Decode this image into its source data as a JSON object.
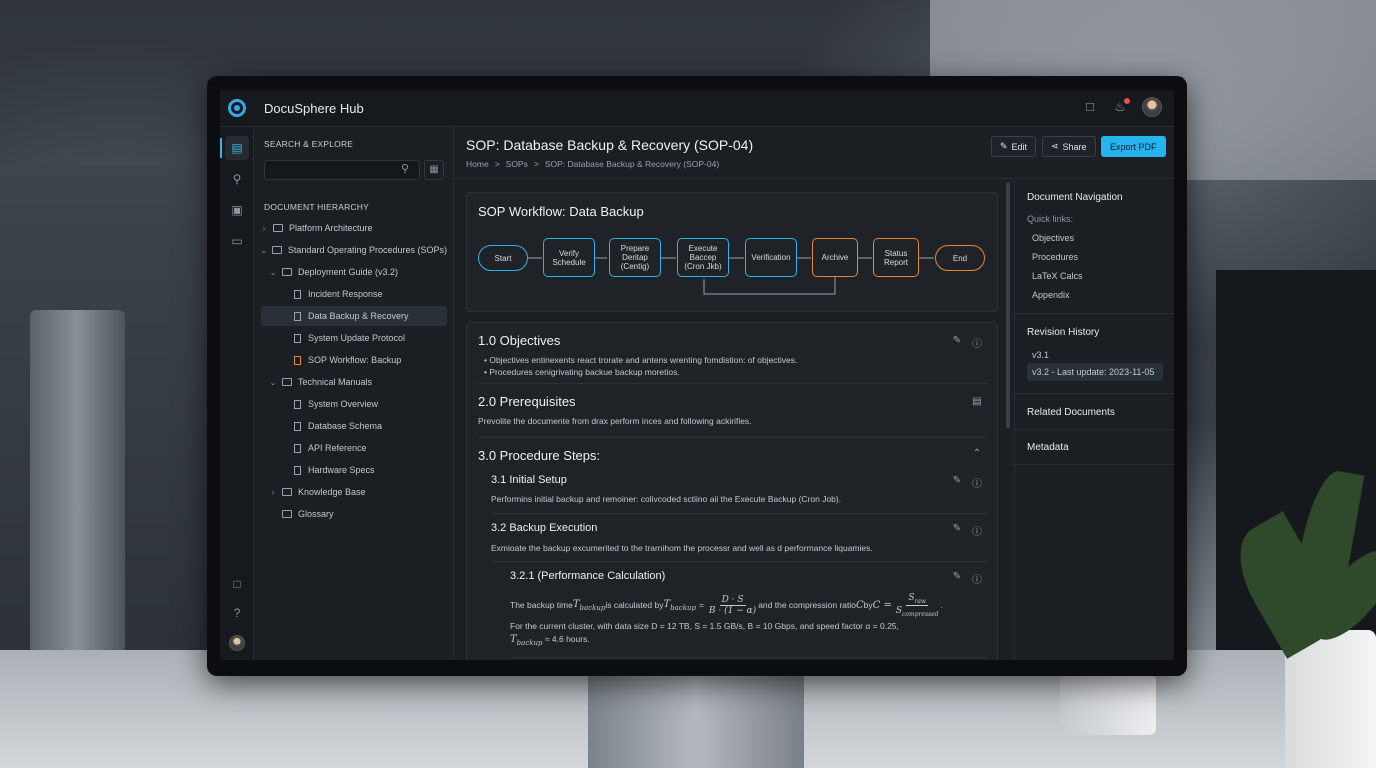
{
  "app": {
    "title": "DocuSphere Hub"
  },
  "sidebar": {
    "search_heading": "SEARCH & EXPLORE",
    "search_placeholder": "",
    "hierarchy_heading": "DOCUMENT HIERARCHY",
    "tree": [
      {
        "label": "Platform Architecture",
        "type": "folder",
        "expanded": false,
        "depth": 0
      },
      {
        "label": "Standard Operating Procedures (SOPs)",
        "type": "folder",
        "expanded": true,
        "depth": 0
      },
      {
        "label": "Deployment Guide (v3.2)",
        "type": "folder",
        "expanded": true,
        "depth": 1
      },
      {
        "label": "Incident Response",
        "type": "file",
        "depth": 2
      },
      {
        "label": "Data Backup & Recovery",
        "type": "file",
        "depth": 2,
        "selected": true
      },
      {
        "label": "System Update Protocol",
        "type": "file",
        "depth": 2
      },
      {
        "label": "SOP Workflow: Backup",
        "type": "file",
        "depth": 2,
        "accent": true
      },
      {
        "label": "Technical Manuals",
        "type": "folder",
        "expanded": true,
        "depth": 1
      },
      {
        "label": "System Overview",
        "type": "file",
        "depth": 2
      },
      {
        "label": "Database Schema",
        "type": "file",
        "depth": 2
      },
      {
        "label": "API Reference",
        "type": "file",
        "depth": 2
      },
      {
        "label": "Hardware Specs",
        "type": "file",
        "depth": 2
      },
      {
        "label": "Knowledge Base",
        "type": "folder",
        "expanded": false,
        "depth": 1
      },
      {
        "label": "Glossary",
        "type": "folder",
        "depth": 1
      }
    ]
  },
  "header": {
    "title": "SOP: Database Backup & Recovery (SOP-04)",
    "breadcrumb": [
      "Home",
      ">",
      "SOPs",
      ">",
      "SOP: Database Backup & Recovery (SOP-04)"
    ],
    "edit_label": "Edit",
    "share_label": "Share",
    "export_label": "Export PDF"
  },
  "workflow": {
    "title": "SOP Workflow: Data Backup",
    "nodes": [
      {
        "label": "Start",
        "style": "blue-pill"
      },
      {
        "label": "Verify\nSchedule",
        "style": "blue"
      },
      {
        "label": "Prepare\nDeritap\n(Centig)",
        "style": "blue"
      },
      {
        "label": "Execute\nBaccep\n(Cron Jkb)",
        "style": "blue"
      },
      {
        "label": "Verification",
        "style": "blue"
      },
      {
        "label": "Archive",
        "style": "orange"
      },
      {
        "label": "Status\nReport",
        "style": "orange"
      },
      {
        "label": "End",
        "style": "orange-pill"
      }
    ]
  },
  "sections": {
    "objectives": {
      "title": "1.0 Objectives",
      "bullets": [
        "Objectives entinexents react trorate and antens wrenting fomdistion: of objectives.",
        "Procedures cenigrivating backue backup moretios."
      ]
    },
    "prerequisites": {
      "title": "2.0 Prerequisites",
      "text": "Prevolite the documente from drax perform inces and following ackirifies."
    },
    "procedure": {
      "title": "3.0 Procedure Steps:",
      "setup_title": "3.1 Initial Setup",
      "setup_text": "Performins initial backup and remoiner: colivcoded sctiino aii the Execute Backup (Cron Job).",
      "exec_title": "3.2 Backup Execution",
      "exec_text": "Exmioate the backup excumerited to the trarnihom the processr and well as d performance liquamies.",
      "perf_title": "3.2.1 (Performance Calculation)",
      "perf_line1_a": "The backup time ",
      "perf_line1_b": " is calculated by ",
      "perf_line1_c": " and the compression ratio ",
      "perf_line1_d": " by ",
      "perf_line2": "For the current cluster, with data size D = 12 TB, S = 1.5 GB/s, B = 10 Gbps, and speed factor α = 0.25,",
      "perf_line3": "≈ 4.6 hours."
    }
  },
  "math": {
    "t_backup": "T",
    "t_sub": "backup",
    "numerator": "D · S",
    "denominator": "B · (1 − α)",
    "C": "C",
    "c_eq": "C =",
    "s_raw": "S",
    "raw_sub": "raw",
    "s_comp": "S",
    "comp_sub": "compressed"
  },
  "right_panel": {
    "nav_title": "Document Navigation",
    "quick_links_label": "Quick links:",
    "quick_links": [
      "Objectives",
      "Procedures",
      "LaTeX Calcs",
      "Appendix"
    ],
    "revision_title": "Revision History",
    "revisions": [
      "v3.1",
      "v3.2 - Last update: 2023-11-05"
    ],
    "related_title": "Related Documents",
    "metadata_title": "Metadata"
  },
  "colors": {
    "accent": "#25b4ef",
    "flow_blue": "#2fb2e8",
    "flow_orange": "#e3863a",
    "notification": "#e5533d"
  }
}
